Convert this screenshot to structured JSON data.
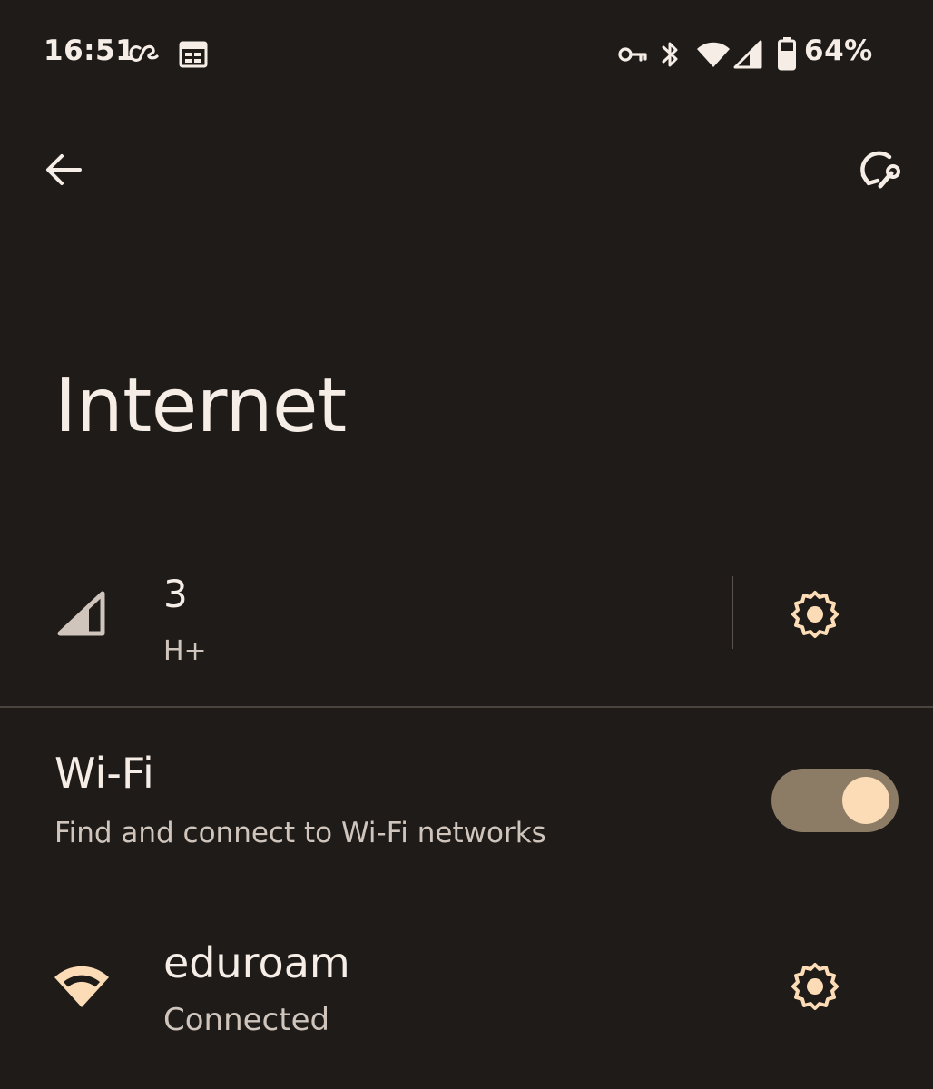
{
  "status_bar": {
    "time": "16:51",
    "battery_percent": "64%",
    "icons_left": [
      "lastfm-icon",
      "calendar-icon"
    ],
    "icons_right": [
      "vpn-key-icon",
      "bluetooth-icon",
      "wifi-icon",
      "cell-signal-icon",
      "battery-icon"
    ]
  },
  "app_bar": {
    "back_icon": "arrow-back-icon",
    "action_icon": "network-reset-icon"
  },
  "page": {
    "title": "Internet"
  },
  "mobile_network": {
    "carrier": "3",
    "network_type": "H+",
    "icon": "cell-signal-icon",
    "settings_icon": "gear-icon"
  },
  "wifi": {
    "title": "Wi-Fi",
    "subtitle": "Find and connect to Wi-Fi networks",
    "enabled": true
  },
  "networks": [
    {
      "name": "eduroam",
      "status": "Connected",
      "icon": "wifi-signal-icon",
      "settings_icon": "gear-icon"
    }
  ],
  "colors": {
    "background": "#1e1b18",
    "primary_text": "#f5ede6",
    "secondary_text": "#cfc5bc",
    "accent": "#fbdcb6",
    "toggle_track": "#8c7b65",
    "divider": "#4a443f"
  }
}
